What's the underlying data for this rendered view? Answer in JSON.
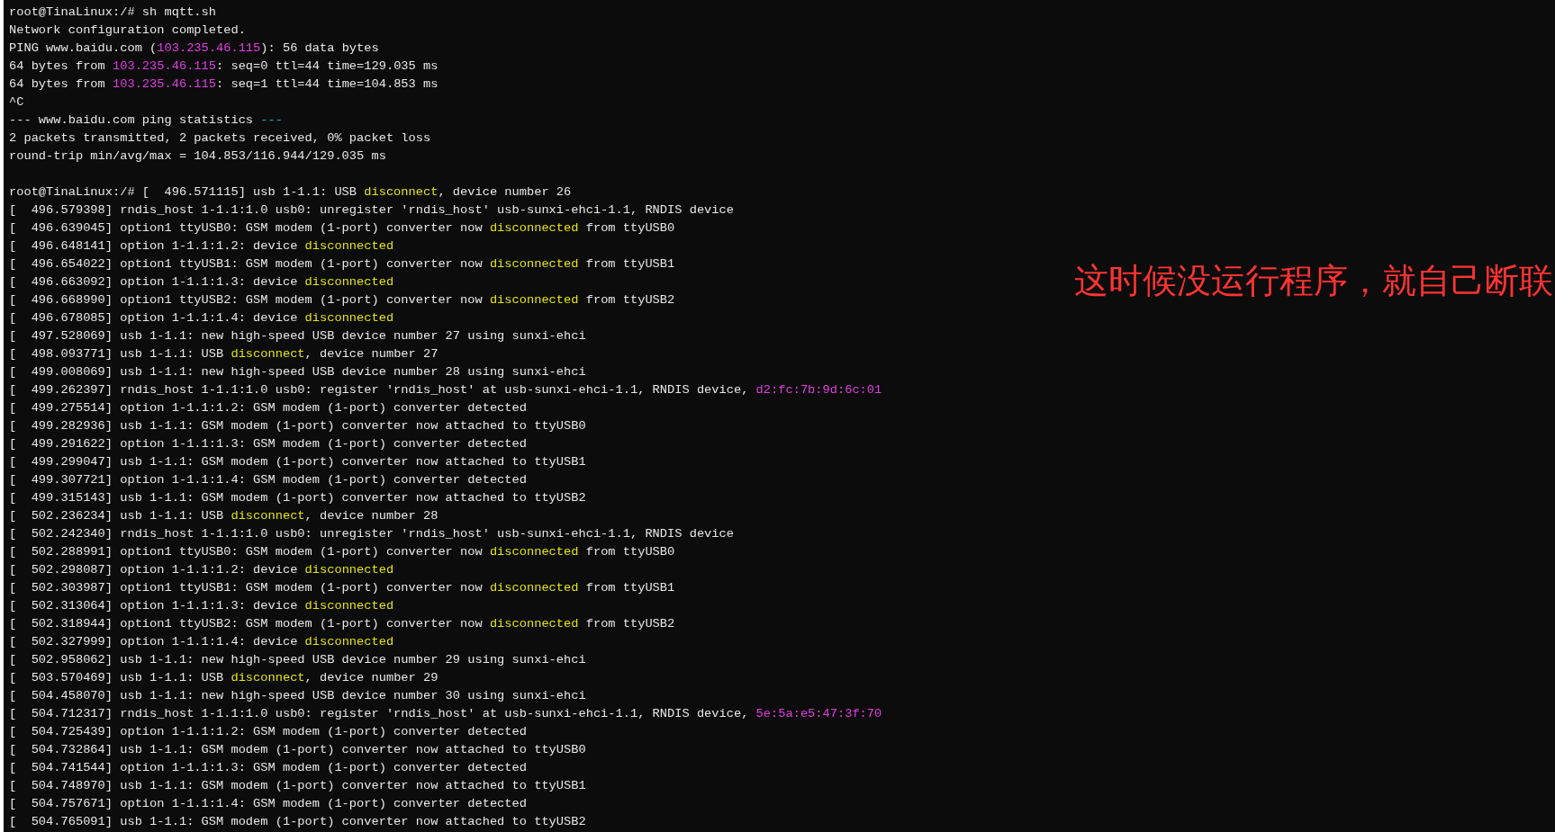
{
  "terminal": {
    "blocks": [
      {
        "lines": [
          [
            {
              "text": "root@TinaLinux:/# sh mqtt.sh",
              "kind": "plain"
            }
          ],
          [
            {
              "text": "Network configuration completed.",
              "kind": "plain"
            }
          ],
          [
            {
              "text": "PING www.baidu.com (",
              "kind": "plain"
            },
            {
              "text": "103.235.46.115",
              "kind": "address"
            },
            {
              "text": "): 56 data bytes",
              "kind": "plain"
            }
          ],
          [
            {
              "text": "64 bytes from ",
              "kind": "plain"
            },
            {
              "text": "103.235.46.115",
              "kind": "address"
            },
            {
              "text": ": seq=0 ttl=44 time=129.035 ms",
              "kind": "plain"
            }
          ],
          [
            {
              "text": "64 bytes from ",
              "kind": "plain"
            },
            {
              "text": "103.235.46.115",
              "kind": "address"
            },
            {
              "text": ": seq=1 ttl=44 time=104.853 ms",
              "kind": "plain"
            }
          ],
          [
            {
              "text": "^C",
              "kind": "plain"
            }
          ],
          [
            {
              "text": "--- www.baidu.com ping statistics ",
              "kind": "plain"
            },
            {
              "text": "---",
              "kind": "accent"
            }
          ],
          [
            {
              "text": "2 packets transmitted, 2 packets received, 0% packet loss",
              "kind": "plain"
            }
          ],
          [
            {
              "text": "round-trip min/avg/max = 104.853/116.944/129.035 ms",
              "kind": "plain"
            }
          ]
        ]
      },
      {
        "lines": [
          [
            {
              "text": "root@TinaLinux:/# [  496.571115] usb 1-1.1: USB ",
              "kind": "plain"
            },
            {
              "text": "disconnect",
              "kind": "warning"
            },
            {
              "text": ", device number 26",
              "kind": "plain"
            }
          ],
          [
            {
              "text": "[  496.579398] rndis_host 1-1.1:1.0 usb0: unregister 'rndis_host' usb-sunxi-ehci-1.1, RNDIS device",
              "kind": "plain"
            }
          ],
          [
            {
              "text": "[  496.639045] option1 ttyUSB0: GSM modem (1-port) converter now ",
              "kind": "plain"
            },
            {
              "text": "disconnected",
              "kind": "warning"
            },
            {
              "text": " from ttyUSB0",
              "kind": "plain"
            }
          ],
          [
            {
              "text": "[  496.648141] option 1-1.1:1.2: device ",
              "kind": "plain"
            },
            {
              "text": "disconnected",
              "kind": "warning"
            }
          ],
          [
            {
              "text": "[  496.654022] option1 ttyUSB1: GSM modem (1-port) converter now ",
              "kind": "plain"
            },
            {
              "text": "disconnected",
              "kind": "warning"
            },
            {
              "text": " from ttyUSB1",
              "kind": "plain"
            }
          ],
          [
            {
              "text": "[  496.663092] option 1-1.1:1.3: device ",
              "kind": "plain"
            },
            {
              "text": "disconnected",
              "kind": "warning"
            }
          ],
          [
            {
              "text": "[  496.668990] option1 ttyUSB2: GSM modem (1-port) converter now ",
              "kind": "plain"
            },
            {
              "text": "disconnected",
              "kind": "warning"
            },
            {
              "text": " from ttyUSB2",
              "kind": "plain"
            }
          ],
          [
            {
              "text": "[  496.678085] option 1-1.1:1.4: device ",
              "kind": "plain"
            },
            {
              "text": "disconnected",
              "kind": "warning"
            }
          ],
          [
            {
              "text": "[  497.528069] usb 1-1.1: new high-speed USB device number 27 using sunxi-ehci",
              "kind": "plain"
            }
          ],
          [
            {
              "text": "[  498.093771] usb 1-1.1: USB ",
              "kind": "plain"
            },
            {
              "text": "disconnect",
              "kind": "warning"
            },
            {
              "text": ", device number 27",
              "kind": "plain"
            }
          ],
          [
            {
              "text": "[  499.008069] usb 1-1.1: new high-speed USB device number 28 using sunxi-ehci",
              "kind": "plain"
            }
          ],
          [
            {
              "text": "[  499.262397] rndis_host 1-1.1:1.0 usb0: register 'rndis_host' at usb-sunxi-ehci-1.1, RNDIS device, ",
              "kind": "plain"
            },
            {
              "text": "d2:fc:7b:9d:6c:01",
              "kind": "address"
            }
          ],
          [
            {
              "text": "[  499.275514] option 1-1.1:1.2: GSM modem (1-port) converter detected",
              "kind": "plain"
            }
          ],
          [
            {
              "text": "[  499.282936] usb 1-1.1: GSM modem (1-port) converter now attached to ttyUSB0",
              "kind": "plain"
            }
          ],
          [
            {
              "text": "[  499.291622] option 1-1.1:1.3: GSM modem (1-port) converter detected",
              "kind": "plain"
            }
          ],
          [
            {
              "text": "[  499.299047] usb 1-1.1: GSM modem (1-port) converter now attached to ttyUSB1",
              "kind": "plain"
            }
          ],
          [
            {
              "text": "[  499.307721] option 1-1.1:1.4: GSM modem (1-port) converter detected",
              "kind": "plain"
            }
          ],
          [
            {
              "text": "[  499.315143] usb 1-1.1: GSM modem (1-port) converter now attached to ttyUSB2",
              "kind": "plain"
            }
          ],
          [
            {
              "text": "[  502.236234] usb 1-1.1: USB ",
              "kind": "plain"
            },
            {
              "text": "disconnect",
              "kind": "warning"
            },
            {
              "text": ", device number 28",
              "kind": "plain"
            }
          ],
          [
            {
              "text": "[  502.242340] rndis_host 1-1.1:1.0 usb0: unregister 'rndis_host' usb-sunxi-ehci-1.1, RNDIS device",
              "kind": "plain"
            }
          ],
          [
            {
              "text": "[  502.288991] option1 ttyUSB0: GSM modem (1-port) converter now ",
              "kind": "plain"
            },
            {
              "text": "disconnected",
              "kind": "warning"
            },
            {
              "text": " from ttyUSB0",
              "kind": "plain"
            }
          ],
          [
            {
              "text": "[  502.298087] option 1-1.1:1.2: device ",
              "kind": "plain"
            },
            {
              "text": "disconnected",
              "kind": "warning"
            }
          ],
          [
            {
              "text": "[  502.303987] option1 ttyUSB1: GSM modem (1-port) converter now ",
              "kind": "plain"
            },
            {
              "text": "disconnected",
              "kind": "warning"
            },
            {
              "text": " from ttyUSB1",
              "kind": "plain"
            }
          ],
          [
            {
              "text": "[  502.313064] option 1-1.1:1.3: device ",
              "kind": "plain"
            },
            {
              "text": "disconnected",
              "kind": "warning"
            }
          ],
          [
            {
              "text": "[  502.318944] option1 ttyUSB2: GSM modem (1-port) converter now ",
              "kind": "plain"
            },
            {
              "text": "disconnected",
              "kind": "warning"
            },
            {
              "text": " from ttyUSB2",
              "kind": "plain"
            }
          ],
          [
            {
              "text": "[  502.327999] option 1-1.1:1.4: device ",
              "kind": "plain"
            },
            {
              "text": "disconnected",
              "kind": "warning"
            }
          ],
          [
            {
              "text": "[  502.958062] usb 1-1.1: new high-speed USB device number 29 using sunxi-ehci",
              "kind": "plain"
            }
          ],
          [
            {
              "text": "[  503.570469] usb 1-1.1: USB ",
              "kind": "plain"
            },
            {
              "text": "disconnect",
              "kind": "warning"
            },
            {
              "text": ", device number 29",
              "kind": "plain"
            }
          ],
          [
            {
              "text": "[  504.458070] usb 1-1.1: new high-speed USB device number 30 using sunxi-ehci",
              "kind": "plain"
            }
          ],
          [
            {
              "text": "[  504.712317] rndis_host 1-1.1:1.0 usb0: register 'rndis_host' at usb-sunxi-ehci-1.1, RNDIS device, ",
              "kind": "plain"
            },
            {
              "text": "5e:5a:e5:47:3f:70",
              "kind": "address"
            }
          ],
          [
            {
              "text": "[  504.725439] option 1-1.1:1.2: GSM modem (1-port) converter detected",
              "kind": "plain"
            }
          ],
          [
            {
              "text": "[  504.732864] usb 1-1.1: GSM modem (1-port) converter now attached to ttyUSB0",
              "kind": "plain"
            }
          ],
          [
            {
              "text": "[  504.741544] option 1-1.1:1.3: GSM modem (1-port) converter detected",
              "kind": "plain"
            }
          ],
          [
            {
              "text": "[  504.748970] usb 1-1.1: GSM modem (1-port) converter now attached to ttyUSB1",
              "kind": "plain"
            }
          ],
          [
            {
              "text": "[  504.757671] option 1-1.1:1.4: GSM modem (1-port) converter detected",
              "kind": "plain"
            }
          ],
          [
            {
              "text": "[  504.765091] usb 1-1.1: GSM modem (1-port) converter now attached to ttyUSB2",
              "kind": "plain"
            }
          ]
        ]
      }
    ]
  },
  "annotation": "这时候没运行程序，就自己断联"
}
